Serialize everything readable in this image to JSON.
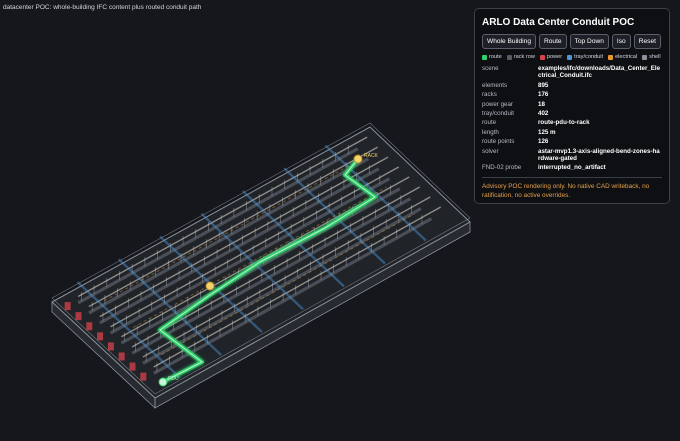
{
  "caption": "datacenter POC: whole-building IFC content plus routed conduit path",
  "panel": {
    "title": "ARLO Data Center Conduit POC",
    "buttons": [
      "Whole Building",
      "Route",
      "Top Down",
      "Iso",
      "Reset"
    ],
    "legend": [
      {
        "label": "route",
        "color": "#2fd06a"
      },
      {
        "label": "rack row",
        "color": "#555a63"
      },
      {
        "label": "power",
        "color": "#d9434b"
      },
      {
        "label": "tray/conduit",
        "color": "#4f96d8"
      },
      {
        "label": "electrical",
        "color": "#e8962e"
      },
      {
        "label": "shell",
        "color": "#8b929c"
      }
    ],
    "details": [
      {
        "key": "scene",
        "value": "examples/ifc/downloads/Data_Center_Electrical_Conduit.ifc"
      },
      {
        "key": "elements",
        "value": "895"
      },
      {
        "key": "racks",
        "value": "176"
      },
      {
        "key": "power gear",
        "value": "18"
      },
      {
        "key": "tray/conduit",
        "value": "402"
      },
      {
        "key": "route",
        "value": "route-pdu-to-rack"
      },
      {
        "key": "length",
        "value": "125 m"
      },
      {
        "key": "route points",
        "value": "126"
      },
      {
        "key": "solver",
        "value": "astar-mvp1.3-axis-aligned-bend-zones-hardware-gated"
      },
      {
        "key": "FND-02 probe",
        "value": "interrupted_no_artifact"
      }
    ],
    "note": "Advisory POC rendering only. No native CAD writeback, no ratification, no active overrides."
  },
  "scene_labels": {
    "route_end": "RACK",
    "route_start": "PDU"
  }
}
